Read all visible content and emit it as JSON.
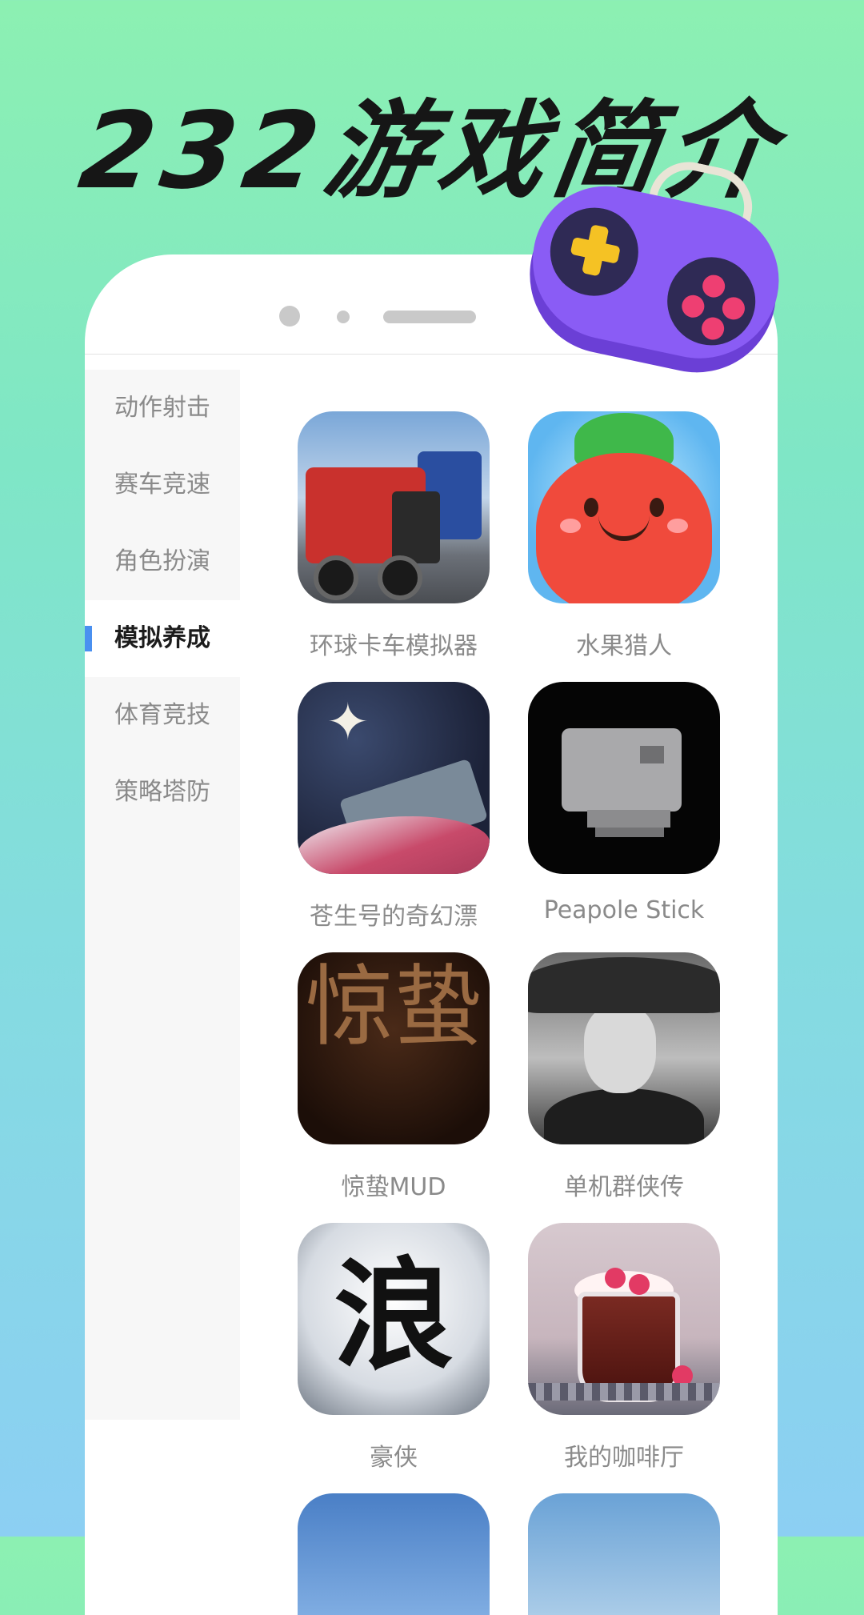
{
  "header": {
    "title": "232游戏简介"
  },
  "sidebar": {
    "items": [
      {
        "label": "动作射击",
        "active": false
      },
      {
        "label": "赛车竞速",
        "active": false
      },
      {
        "label": "角色扮演",
        "active": false
      },
      {
        "label": "模拟养成",
        "active": true
      },
      {
        "label": "体育竞技",
        "active": false
      },
      {
        "label": "策略塔防",
        "active": false
      }
    ]
  },
  "games": [
    {
      "name": "环球卡车模拟器",
      "icon": "truck-icon"
    },
    {
      "name": "水果猎人",
      "icon": "fruit-character-icon"
    },
    {
      "name": "苍生号的奇幻漂",
      "icon": "fantasy-ship-icon"
    },
    {
      "name": "Peapole Stick",
      "icon": "pixel-block-icon"
    },
    {
      "name": "惊蛰MUD",
      "icon": "calligraphy-icon",
      "art_text": "惊蛰"
    },
    {
      "name": "单机群侠传",
      "icon": "swordsman-icon"
    },
    {
      "name": "豪侠",
      "icon": "calligraphy-icon",
      "art_text": "浪"
    },
    {
      "name": "我的咖啡厅",
      "icon": "coffee-cup-icon"
    }
  ],
  "colors": {
    "accent": "#4a90f0",
    "controller": "#8a5cf5",
    "background_top": "#8cf0b2",
    "background_bottom": "#8ccff3"
  }
}
